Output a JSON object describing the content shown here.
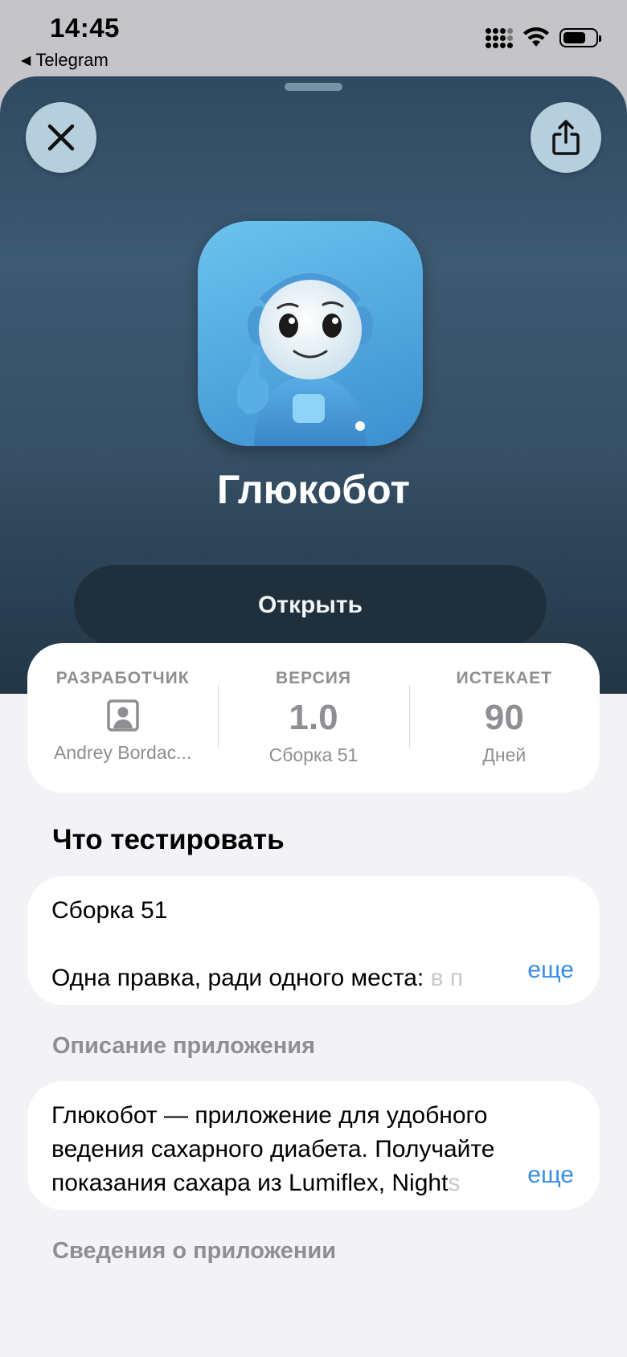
{
  "status_bar": {
    "time": "14:45",
    "back_app": "Telegram",
    "back_icon": "back-triangle-icon"
  },
  "header": {
    "close_icon": "close-icon",
    "share_icon": "share-icon"
  },
  "app": {
    "name": "Глюкобот",
    "open_button": "Открыть",
    "icon": "robot-app-icon"
  },
  "info": {
    "developer": {
      "label": "РАЗРАБОТЧИК",
      "icon": "person-icon",
      "value": "Andrey Bordac..."
    },
    "version": {
      "label": "ВЕРСИЯ",
      "value": "1.0",
      "sub": "Сборка 51"
    },
    "expires": {
      "label": "ИСТЕКАЕТ",
      "value": "90",
      "sub": "Дней"
    }
  },
  "what_to_test": {
    "title": "Что тестировать",
    "line1": "Сборка 51",
    "line2_visible": "Одна правка, ради одного места: ",
    "line2_fade": "в п",
    "more": "еще"
  },
  "description": {
    "title": "Описание приложения",
    "line1": "Глюкобот — приложение для удобного",
    "line2": "ведения сахарного диабета. Получайте",
    "line3_visible": "показания сахара из Lumiflex, Night",
    "line3_fade": "s",
    "more": "еще"
  },
  "app_info": {
    "title": "Сведения о приложении"
  }
}
